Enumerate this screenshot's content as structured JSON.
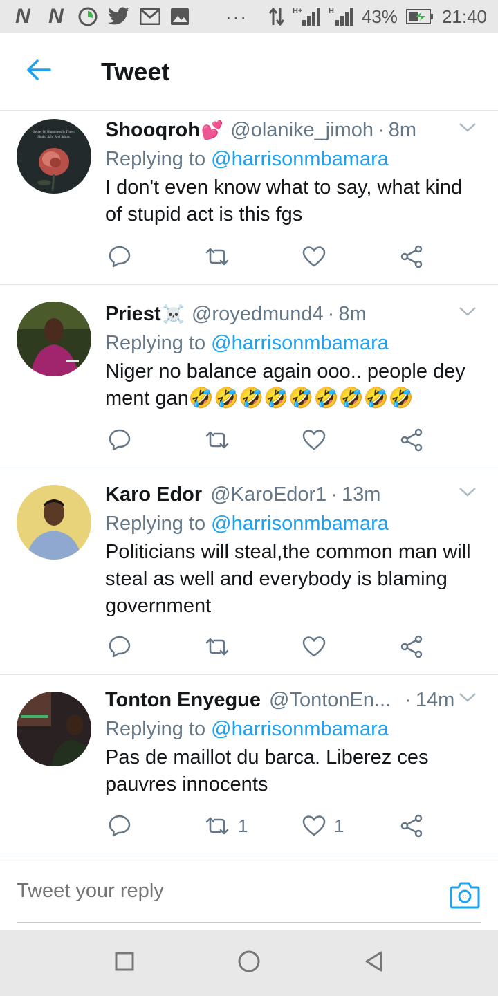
{
  "status_bar": {
    "battery": "43%",
    "time": "21:40",
    "network_label": "H+"
  },
  "header": {
    "title": "Tweet"
  },
  "reply_prefix": "Replying to",
  "tweets": [
    {
      "name": "Shooqroh",
      "emoji": "💕",
      "handle": "@olanike_jimoh",
      "time": "8m",
      "reply_to": "@harrisonmbamara",
      "text": "I don't even know what to say, what kind of stupid act is this fgs",
      "retweets": "",
      "likes": "",
      "avatar_lettering": "Secret Of Happiness Is Three: Shukr, Sabr And Ikhlas."
    },
    {
      "name": "Priest",
      "emoji": "☠️",
      "handle": "@royedmund4",
      "time": "8m",
      "reply_to": "@harrisonmbamara",
      "text": "Niger no balance again ooo.. people dey ment gan🤣🤣🤣🤣🤣🤣🤣🤣🤣",
      "retweets": "",
      "likes": ""
    },
    {
      "name": "Karo Edor",
      "emoji": "",
      "handle": "@KaroEdor1",
      "time": "13m",
      "reply_to": "@harrisonmbamara",
      "text": "Politicians will steal,the common man will steal as well and everybody is blaming government",
      "retweets": "",
      "likes": ""
    },
    {
      "name": "Tonton Enyegue",
      "emoji": "",
      "handle": "@TontonEn...",
      "time": "14m",
      "reply_to": "@harrisonmbamara",
      "text": "Pas de maillot du barca. Liberez ces pauvres innocents",
      "retweets": "1",
      "likes": "1"
    }
  ],
  "reply_bar": {
    "placeholder": "Tweet your reply"
  },
  "colors": {
    "accent": "#1da1f2",
    "muted": "#657786",
    "text": "#14171a",
    "divider": "#e1e8ed"
  },
  "icons": {
    "back": "arrow-left-icon",
    "reply": "reply-icon",
    "retweet": "retweet-icon",
    "like": "heart-icon",
    "share": "share-icon",
    "caret": "chevron-down-icon",
    "camera": "camera-icon"
  }
}
